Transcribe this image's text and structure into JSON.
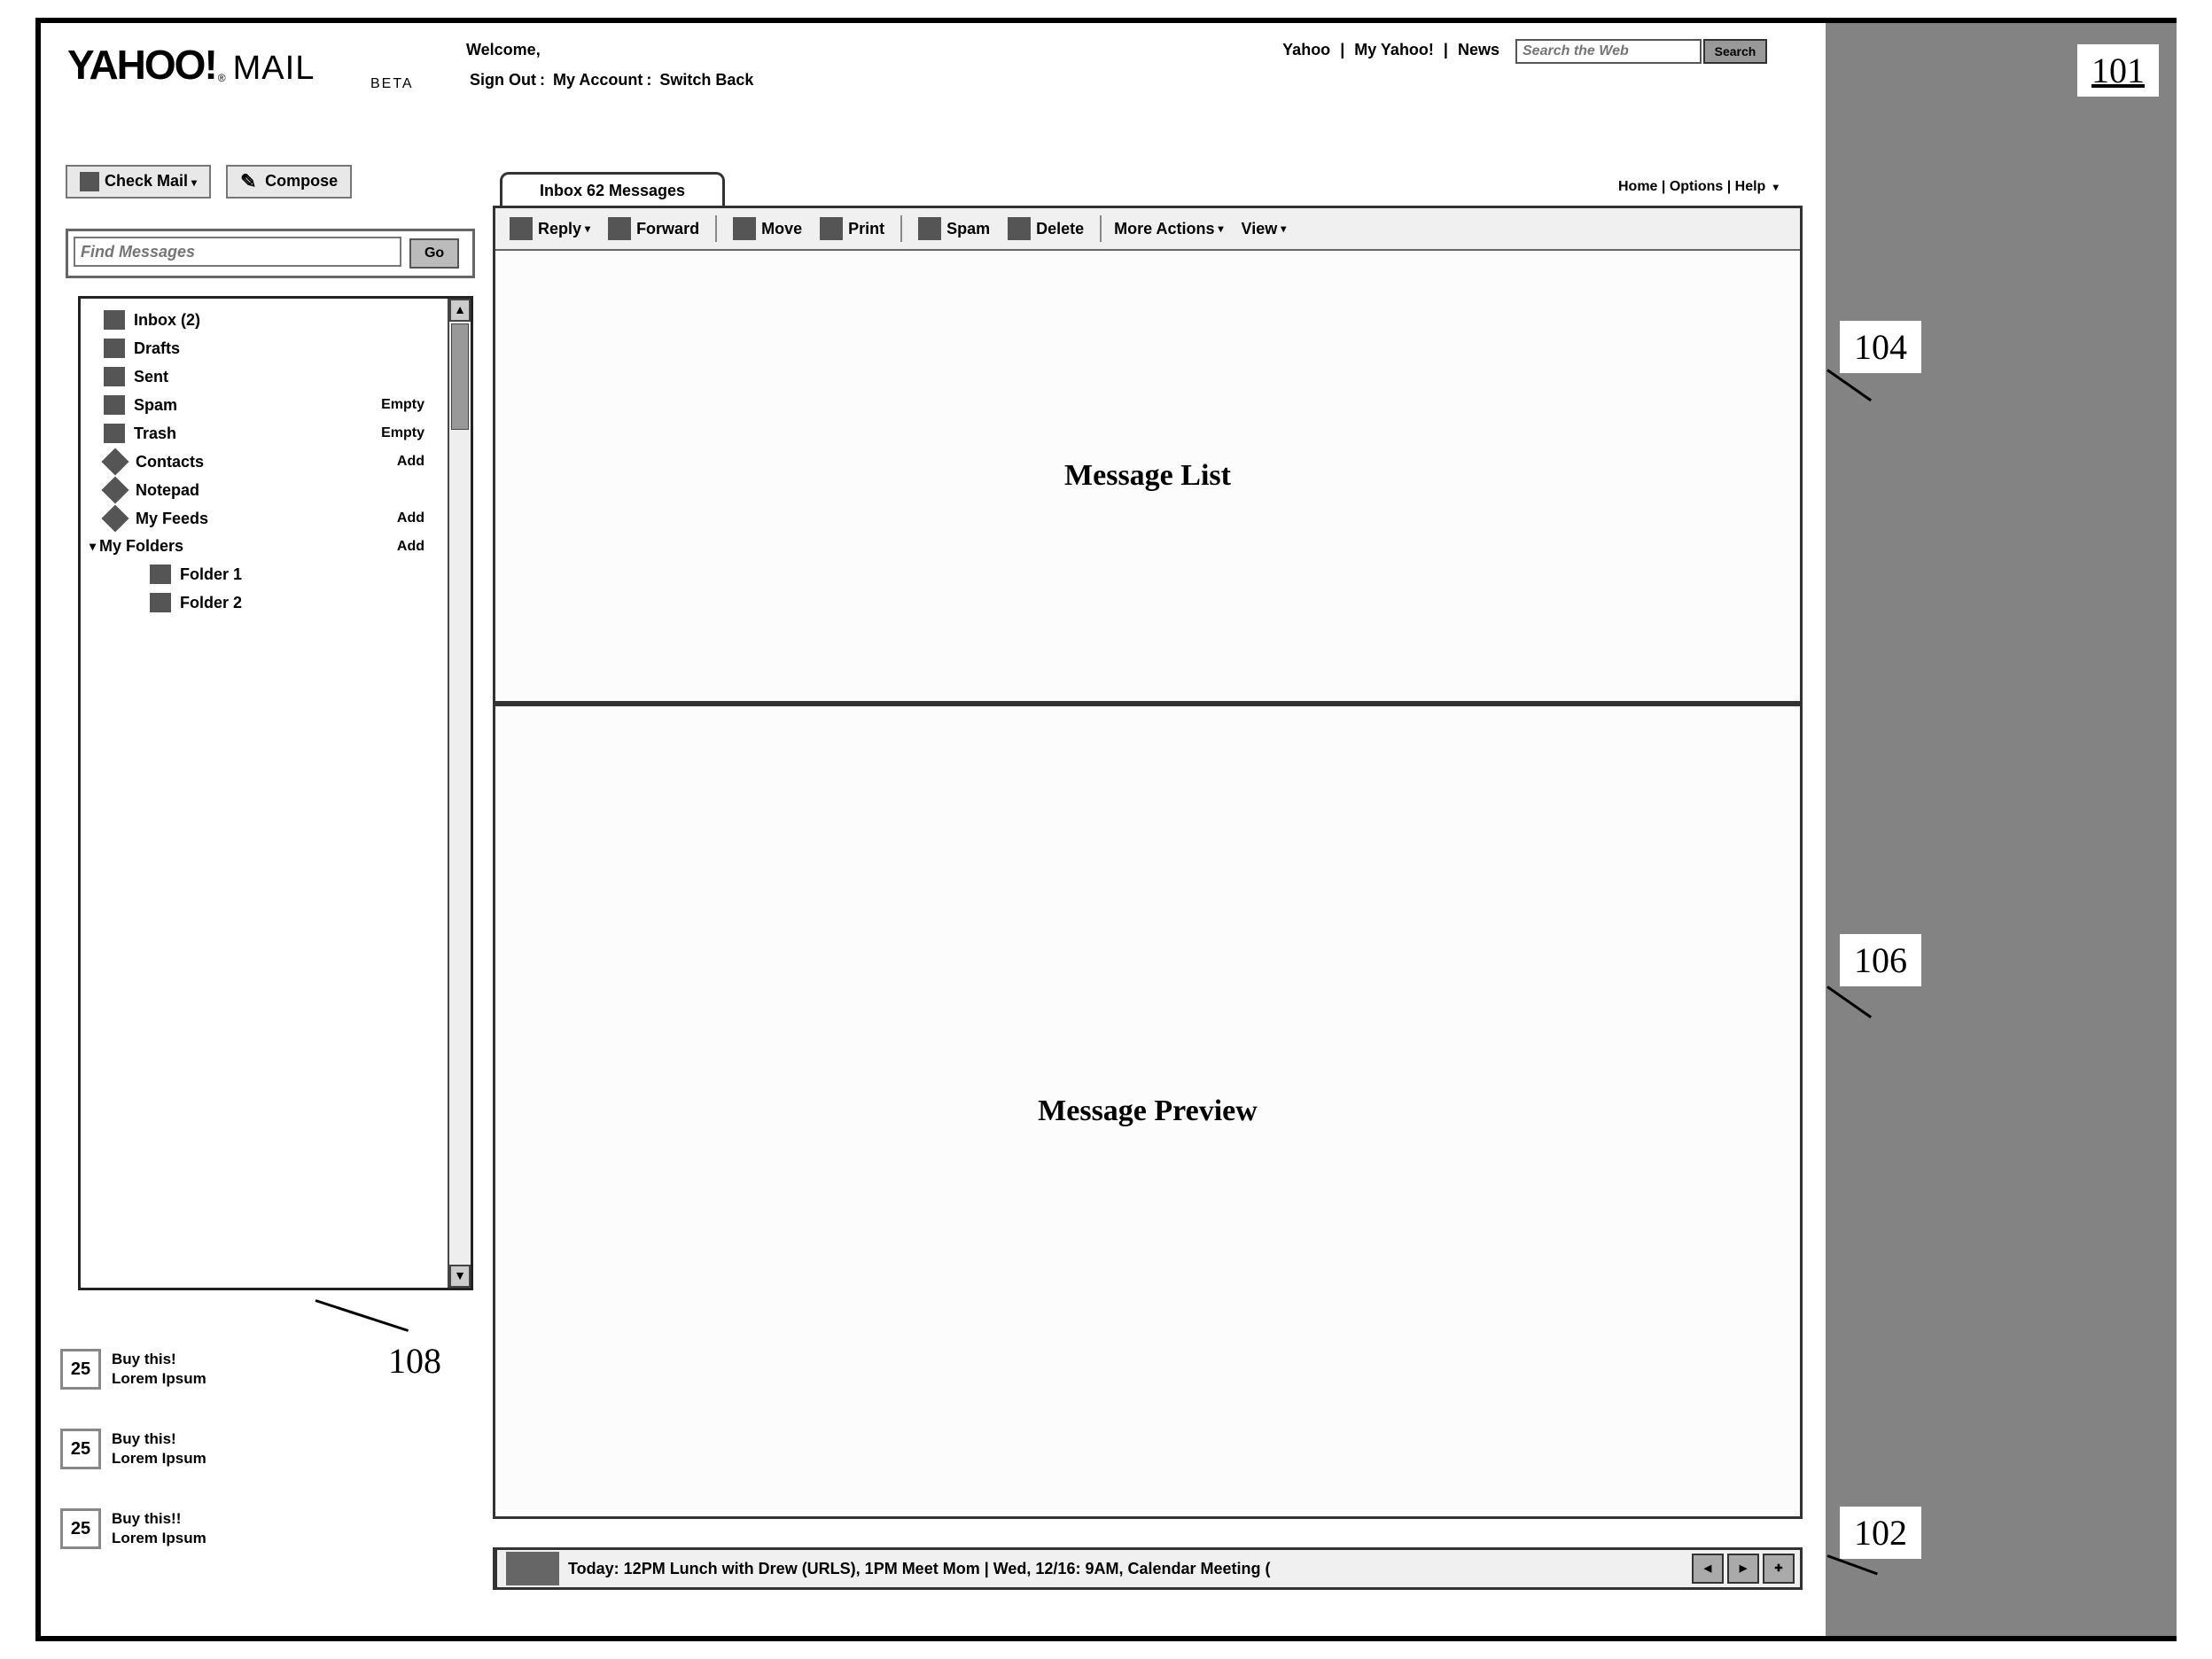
{
  "logo": {
    "brand": "YAHOO",
    "bang": "!",
    "product": "MAIL",
    "beta": "BETA",
    "reg": "®"
  },
  "header": {
    "welcome": "Welcome,",
    "links": {
      "signout": "Sign Out",
      "myaccount": "My Account",
      "switchback": "Switch Back"
    },
    "nav": {
      "yahoo": "Yahoo",
      "myyahoo": "My Yahoo!",
      "news": "News"
    },
    "search_placeholder": "Search the Web",
    "search_button": "Search"
  },
  "toolbar": {
    "checkmail": "Check Mail",
    "compose": "Compose"
  },
  "find": {
    "placeholder": "Find Messages",
    "go": "Go"
  },
  "folders": {
    "items": [
      {
        "label": "Inbox (2)"
      },
      {
        "label": "Drafts"
      },
      {
        "label": "Sent"
      },
      {
        "label": "Spam",
        "hint": "Empty"
      },
      {
        "label": "Trash",
        "hint": "Empty"
      }
    ],
    "contacts": {
      "label": "Contacts",
      "hint": "Add"
    },
    "notepad": {
      "label": "Notepad"
    },
    "feeds": {
      "label": "My Feeds",
      "hint": "Add"
    },
    "myfolders": {
      "label": "My Folders",
      "hint": "Add"
    },
    "custom": [
      {
        "label": "Folder 1"
      },
      {
        "label": "Folder 2"
      }
    ]
  },
  "ads": [
    {
      "num": "25",
      "title": "Buy this!",
      "sub": "Lorem Ipsum"
    },
    {
      "num": "25",
      "title": "Buy this!",
      "sub": "Lorem Ipsum"
    },
    {
      "num": "25",
      "title": "Buy this!!",
      "sub": "Lorem Ipsum"
    }
  ],
  "content": {
    "tab": "Inbox 62 Messages",
    "toplinks": {
      "home": "Home",
      "options": "Options",
      "help": "Help"
    },
    "tbar": {
      "reply": "Reply",
      "forward": "Forward",
      "move": "Move",
      "print": "Print",
      "spam": "Spam",
      "delete": "Delete",
      "more": "More Actions",
      "view": "View"
    },
    "list_placeholder": "Message List",
    "preview_placeholder": "Message Preview"
  },
  "ticker": {
    "text": "Today: 12PM  Lunch with Drew (URLS), 1PM  Meet Mom  |  Wed, 12/16:  9AM, Calendar Meeting ("
  },
  "callouts": {
    "c101": "101",
    "c102": "102",
    "c104": "104",
    "c106": "106",
    "c108": "108"
  }
}
